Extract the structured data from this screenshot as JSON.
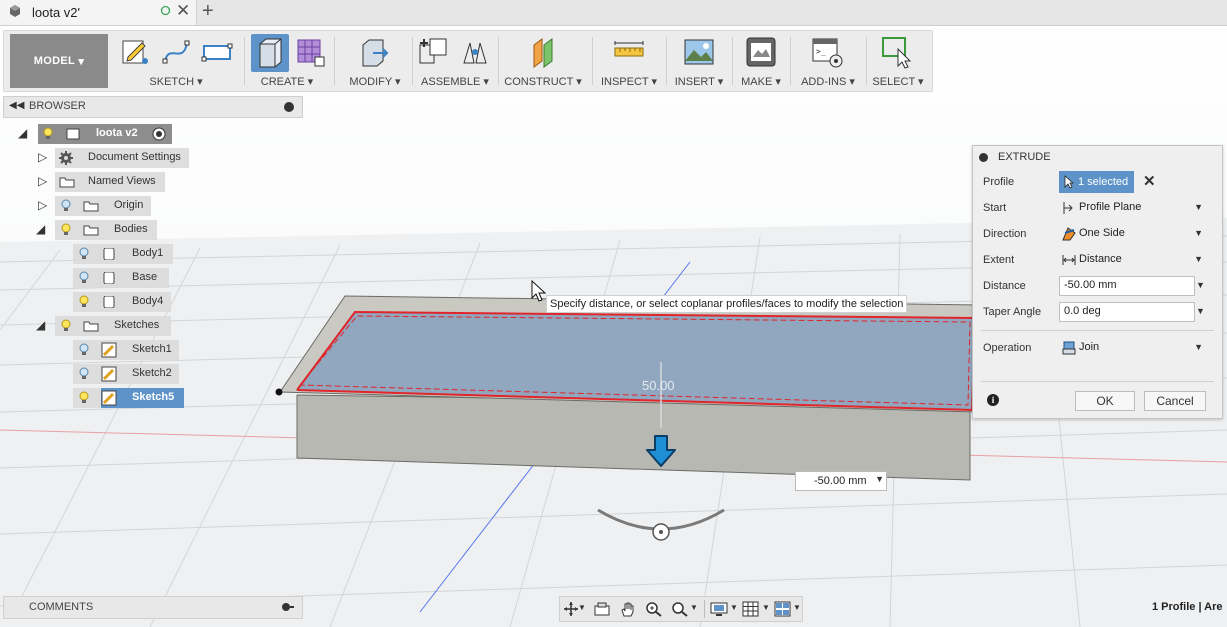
{
  "tab": {
    "title": "loota v2",
    "modified_mark": "'",
    "new_tab_symbol": "+"
  },
  "toolbar": {
    "workspace": "MODEL",
    "groups": [
      {
        "label": "SKETCH"
      },
      {
        "label": "CREATE"
      },
      {
        "label": "MODIFY"
      },
      {
        "label": "ASSEMBLE"
      },
      {
        "label": "CONSTRUCT"
      },
      {
        "label": "INSPECT"
      },
      {
        "label": "INSERT"
      },
      {
        "label": "MAKE"
      },
      {
        "label": "ADD-INS"
      },
      {
        "label": "SELECT"
      }
    ]
  },
  "browser": {
    "title": "BROWSER",
    "root": "loota v2",
    "items": [
      {
        "label": "Document Settings"
      },
      {
        "label": "Named Views"
      },
      {
        "label": "Origin"
      },
      {
        "label": "Bodies"
      },
      {
        "label": "Body1"
      },
      {
        "label": "Base"
      },
      {
        "label": "Body4"
      },
      {
        "label": "Sketches"
      },
      {
        "label": "Sketch1"
      },
      {
        "label": "Sketch2"
      },
      {
        "label": "Sketch5"
      }
    ]
  },
  "canvas": {
    "hint": "Specify distance, or select coplanar profiles/faces to modify the selection",
    "distance_value": "-50.00 mm",
    "ghost_dimension": "50.00"
  },
  "extrude": {
    "title": "EXTRUDE",
    "fields": {
      "profile": {
        "label": "Profile",
        "value": "1 selected"
      },
      "start": {
        "label": "Start",
        "value": "Profile Plane"
      },
      "direction": {
        "label": "Direction",
        "value": "One Side"
      },
      "extent": {
        "label": "Extent",
        "value": "Distance"
      },
      "distance": {
        "label": "Distance",
        "value": "-50.00 mm"
      },
      "taper": {
        "label": "Taper Angle",
        "value": "0.0 deg"
      },
      "operation": {
        "label": "Operation",
        "value": "Join"
      }
    },
    "ok": "OK",
    "cancel": "Cancel"
  },
  "comments": {
    "title": "COMMENTS"
  },
  "status": {
    "text": "1 Profile | Are"
  },
  "colors": {
    "accent": "#5d93c8",
    "selection_edge": "#e0252b",
    "face_blue": "#7d9cc0",
    "arrow_blue": "#1f8fd6"
  }
}
